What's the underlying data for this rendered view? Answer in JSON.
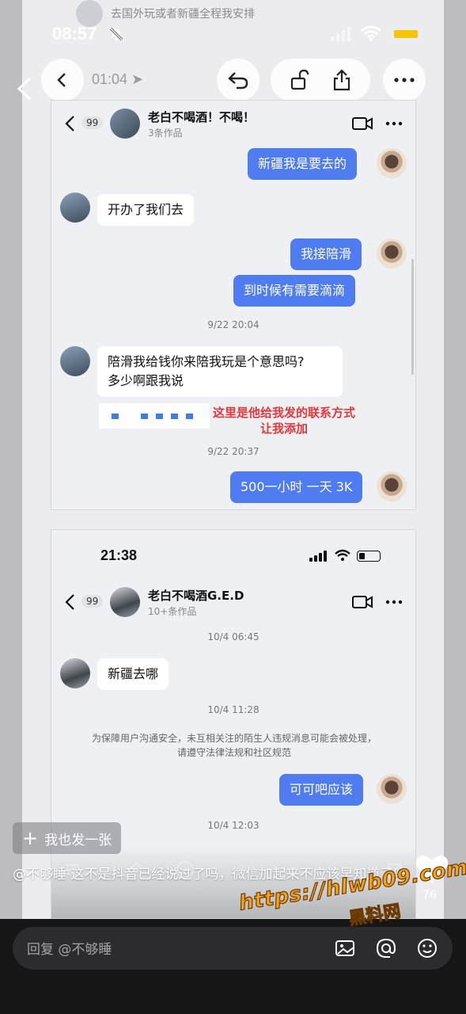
{
  "notification": {
    "text": "去国外玩或者新疆全程我安排"
  },
  "status_bar": {
    "time": "08:57"
  },
  "recording_header": {
    "time": "01:04"
  },
  "chat1": {
    "name": "老白不喝酒！不喝！",
    "works": "3条作品",
    "unread": "99",
    "messages": [
      {
        "side": "me",
        "text": "新疆我是要去的"
      },
      {
        "side": "them",
        "text": "开办了我们去"
      },
      {
        "side": "me",
        "text": "我接陪滑"
      },
      {
        "side": "me",
        "text": "到时候有需要滴滴"
      },
      {
        "side": "stamp",
        "text": "9/22 20:04"
      },
      {
        "side": "them",
        "text": "陪滑我给钱你来陪我玩是个意思吗?"
      },
      {
        "side": "them",
        "text": "多少啊跟我说"
      },
      {
        "side": "stamp",
        "text": "9/22 20:37"
      },
      {
        "side": "me",
        "text": "500一小时 一天 3K"
      }
    ],
    "annotation_line1": "这里是他给我发的联系方式",
    "annotation_line2": "让我添加"
  },
  "chat2": {
    "status_time": "21:38",
    "name": "老白不喝酒G.E.D",
    "works": "10+条作品",
    "unread": "99",
    "messages": [
      {
        "side": "stamp",
        "text": "10/4 06:45"
      },
      {
        "side": "them",
        "text": "新疆去哪"
      },
      {
        "side": "stamp",
        "text": "10/4 11:28"
      },
      {
        "side": "notice",
        "text": "为保障用户沟通安全，未互相关注的陌生人违规消息可能会被处理，请遵守法律法规和社区规范"
      },
      {
        "side": "me",
        "text": "可可吧应该"
      },
      {
        "side": "stamp",
        "text": "10/4 12:03"
      }
    ]
  },
  "overlay": {
    "also_post": "我也发一张",
    "comment": "@不够睡·这不是抖音已经说过了吗，微信加起来不应该早知道了吗",
    "like_count": "76"
  },
  "reply": {
    "placeholder": "回复 @不够睡"
  },
  "watermark": {
    "url": "https://hlwb09.com",
    "cn": "黑料网"
  }
}
